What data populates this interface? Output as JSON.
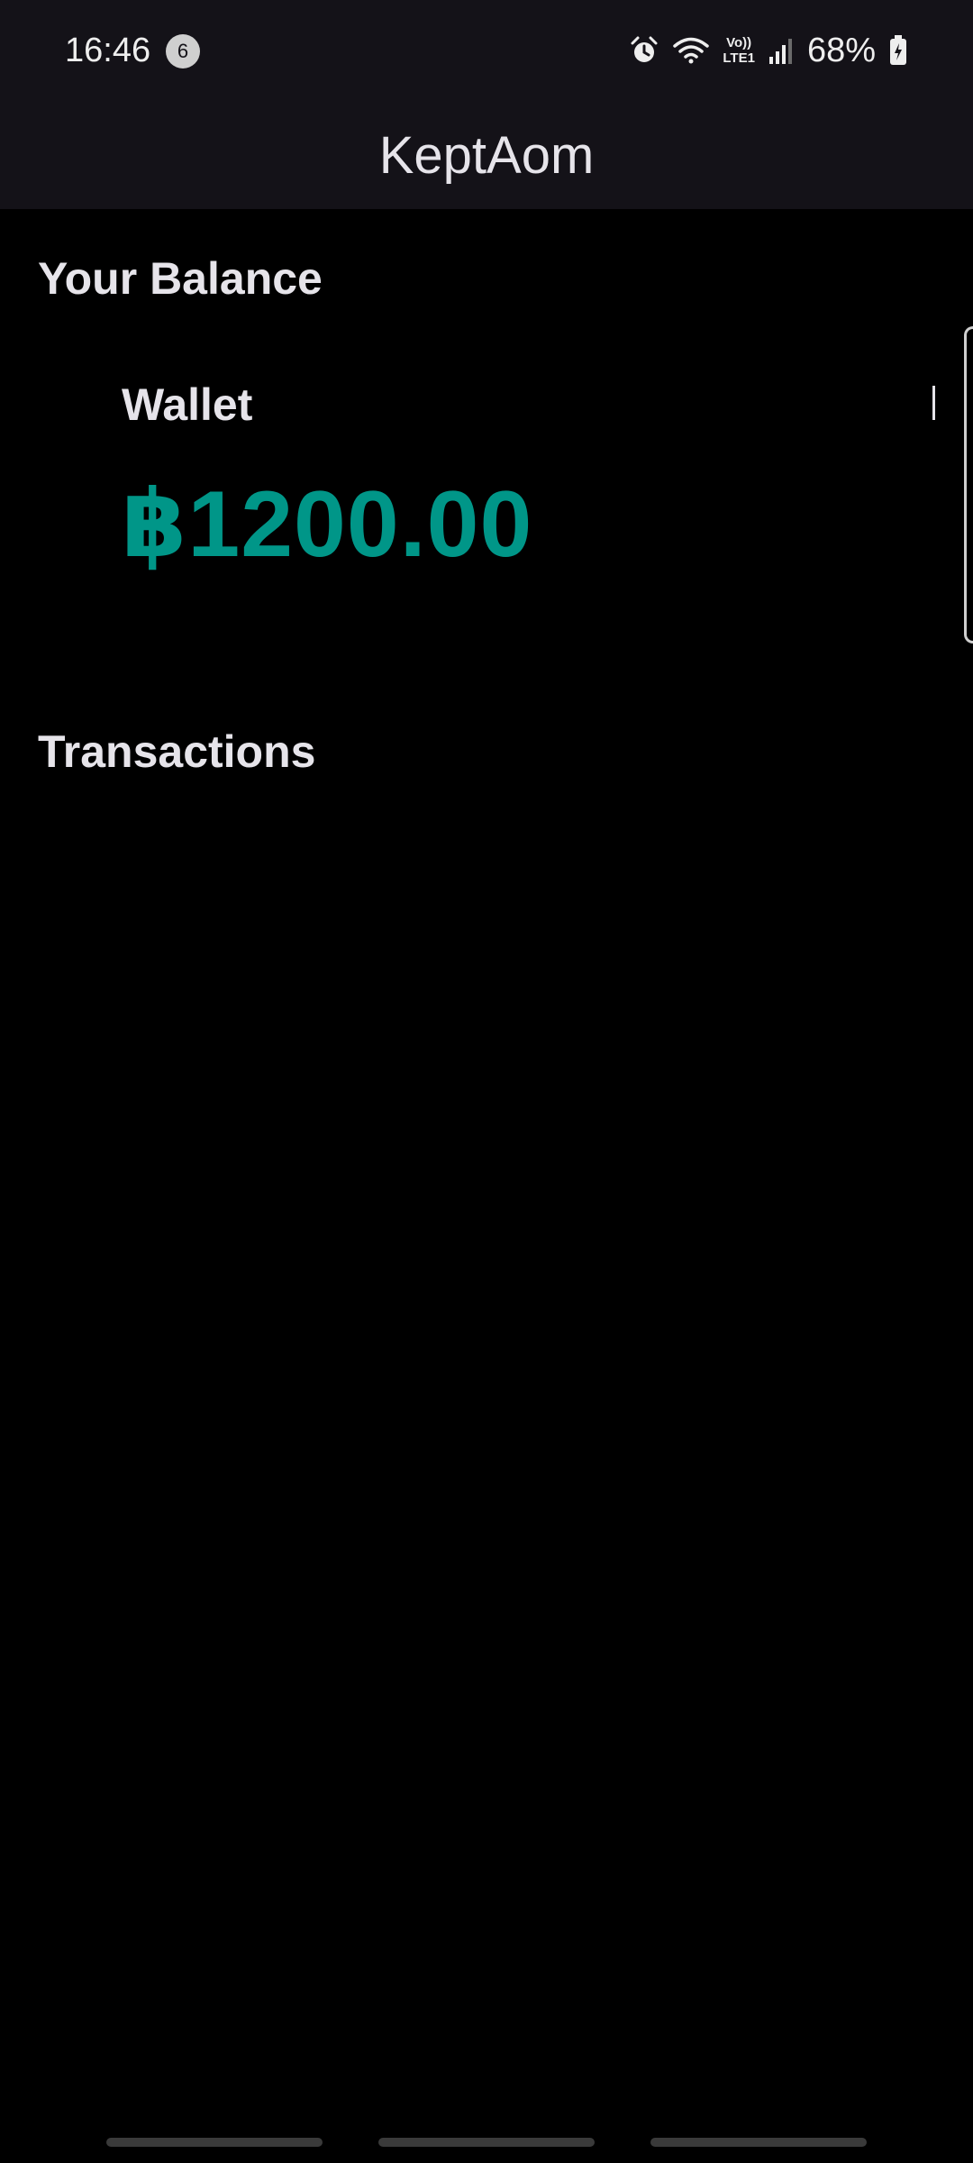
{
  "status_bar": {
    "time": "16:46",
    "notification_count": "6",
    "volte_line1": "Vo))",
    "volte_line2": "LTE1",
    "battery_percent": "68%",
    "icons": [
      "alarm-icon",
      "wifi-icon",
      "volte-icon",
      "signal-icon",
      "battery-charging-icon"
    ]
  },
  "app_bar": {
    "title": "KeptAom"
  },
  "balance": {
    "section_title": "Your Balance",
    "wallet_label": "Wallet",
    "wallet_amount": "฿1200.00",
    "amount_color": "#009688"
  },
  "transactions": {
    "section_title": "Transactions",
    "items": []
  },
  "colors": {
    "background": "#000000",
    "top_bar": "#141218",
    "text": "#e6e4ea",
    "accent": "#009688"
  }
}
